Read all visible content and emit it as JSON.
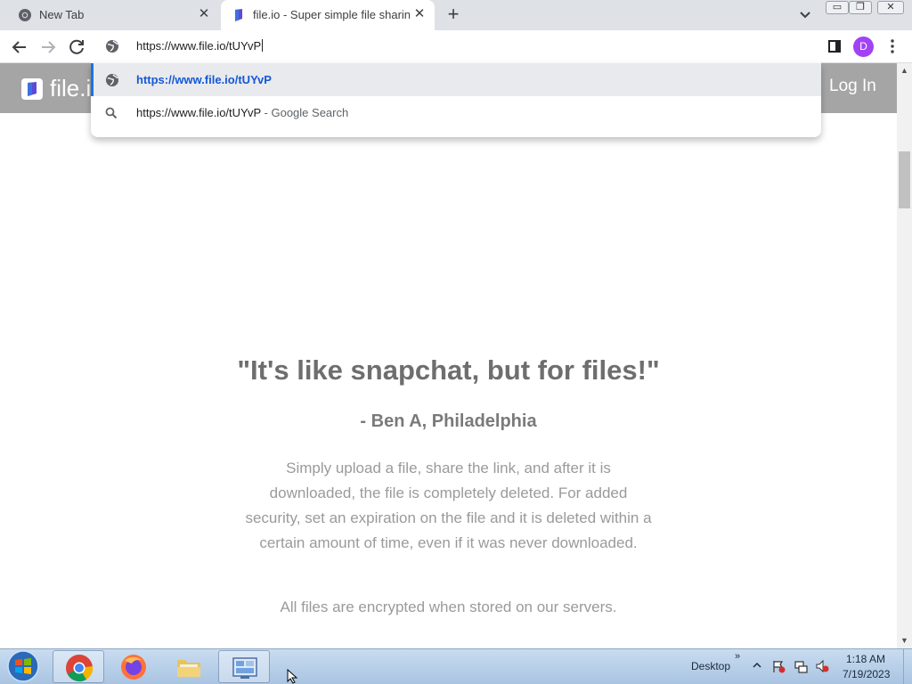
{
  "browser": {
    "tabs": [
      {
        "title": "New Tab",
        "favicon": "chrome-icon",
        "active": false
      },
      {
        "title": "file.io - Super simple file sharing",
        "favicon": "fileio-icon",
        "active": true
      }
    ],
    "new_tab_label": "+",
    "window_controls": {
      "minimize": "▭",
      "restore": "❐",
      "close": "✕"
    },
    "address_bar": {
      "value": "https://www.file.io/tUYvP"
    },
    "profile_initial": "D",
    "suggestions": [
      {
        "text": "https://www.file.io/tUYvP",
        "suffix": "",
        "icon": "globe-icon"
      },
      {
        "text": "https://www.file.io/tUYvP",
        "suffix": " - Google Search",
        "icon": "search-icon"
      }
    ]
  },
  "page": {
    "logo_text": "file.io",
    "login_label": "Log In",
    "quote": "\"It's like snapchat, but for files!\"",
    "attribution": "- Ben A, Philadelphia",
    "description": "Simply upload a file, share the link, and after it is downloaded, the file is completely deleted. For added security, set an expiration on the file and it is deleted within a certain amount of time, even if it was never downloaded.",
    "encryption_note": "All files are encrypted when stored on our servers."
  },
  "taskbar": {
    "desktop_label": "Desktop",
    "expand_label": "»",
    "clock_time": "1:18 AM",
    "clock_date": "7/19/2023"
  },
  "colors": {
    "header_bg": "#a5a5a5",
    "accent_blue": "#1558d6",
    "avatar": "#a142f4"
  }
}
